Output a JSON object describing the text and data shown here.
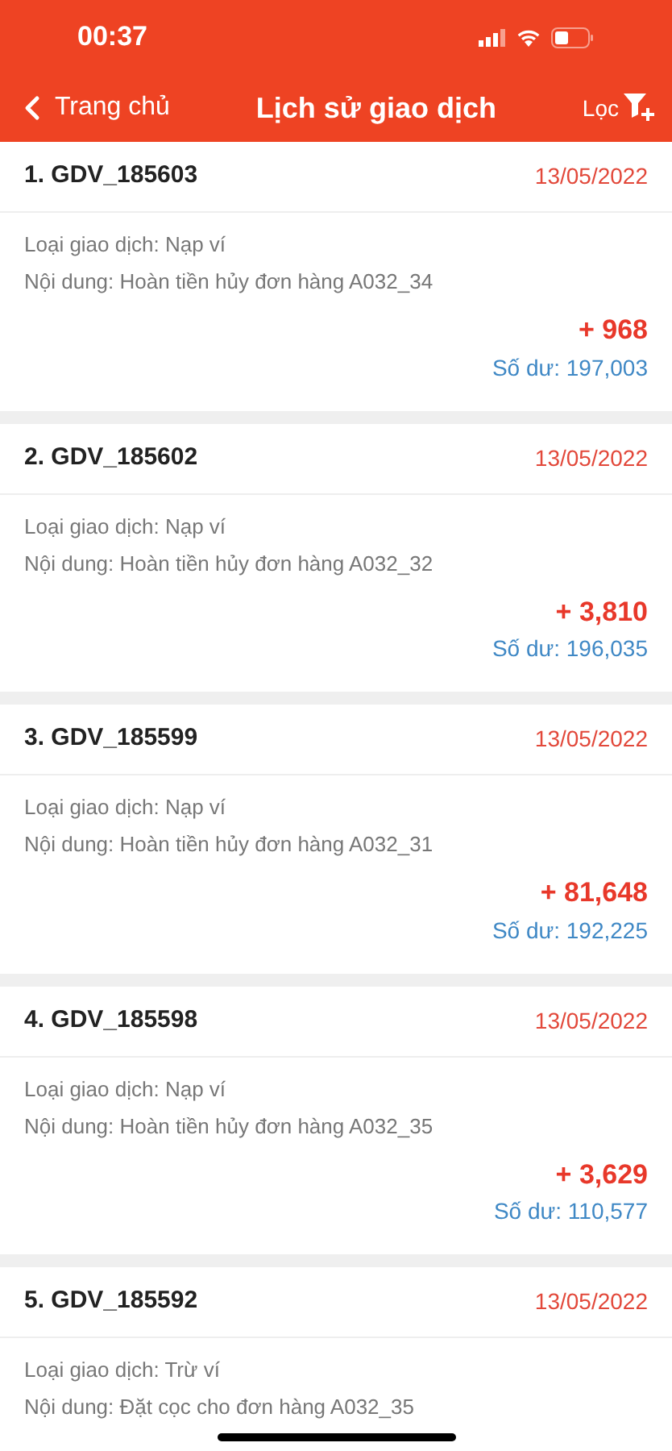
{
  "status_bar": {
    "time": "00:37"
  },
  "nav": {
    "back_label": "Trang chủ",
    "title": "Lịch sử giao dịch",
    "filter_label": "Lọc"
  },
  "transactions": [
    {
      "code": "1. GDV_185603",
      "date": "13/05/2022",
      "type": "Loại giao dịch: Nạp ví",
      "content": "Nội dung: Hoàn tiền hủy đơn hàng A032_34",
      "amount": "+ 968",
      "balance": "Số dư: 197,003"
    },
    {
      "code": "2. GDV_185602",
      "date": "13/05/2022",
      "type": "Loại giao dịch: Nạp ví",
      "content": "Nội dung: Hoàn tiền hủy đơn hàng A032_32",
      "amount": "+ 3,810",
      "balance": "Số dư: 196,035"
    },
    {
      "code": "3. GDV_185599",
      "date": "13/05/2022",
      "type": "Loại giao dịch: Nạp ví",
      "content": "Nội dung: Hoàn tiền hủy đơn hàng A032_31",
      "amount": "+ 81,648",
      "balance": "Số dư: 192,225"
    },
    {
      "code": "4. GDV_185598",
      "date": "13/05/2022",
      "type": "Loại giao dịch: Nạp ví",
      "content": "Nội dung: Hoàn tiền hủy đơn hàng A032_35",
      "amount": "+ 3,629",
      "balance": "Số dư: 110,577"
    },
    {
      "code": "5. GDV_185592",
      "date": "13/05/2022",
      "type": "Loại giao dịch: Trừ ví",
      "content": "Nội dung: Đặt cọc cho đơn hàng A032_35"
    }
  ]
}
